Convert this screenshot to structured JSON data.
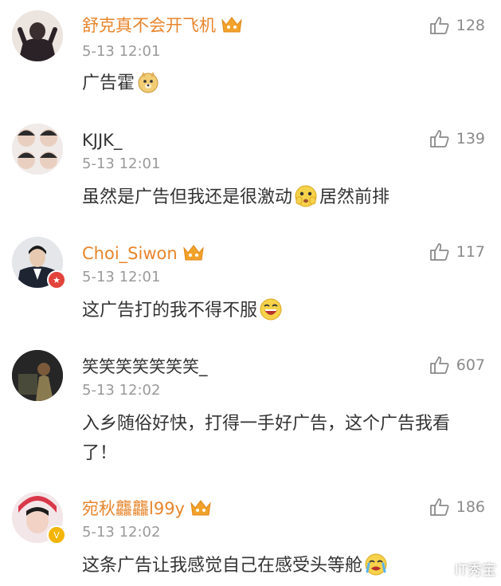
{
  "comments": [
    {
      "username": "舒克真不会开飞机",
      "time": "5-13 12:01",
      "text": "广告霍",
      "likes": "128"
    },
    {
      "username": "KJJK_",
      "time": "5-13 12:01",
      "text_before": "虽然是广告但我还是很激动",
      "text_after": "居然前排",
      "likes": "139"
    },
    {
      "username": "Choi_Siwon",
      "time": "5-13 12:01",
      "text": "这广告打的我不得不服",
      "likes": "117"
    },
    {
      "username": "笑笑笑笑笑笑笑_",
      "time": "5-13 12:02",
      "text": "入乡随俗好快，打得一手好广告，这个广告我看了！",
      "likes": "607"
    },
    {
      "username": "宛秋龘龘l99y",
      "time": "5-13 12:02",
      "text": "这条广告让我感觉自己在感受头等舱",
      "likes": "186"
    }
  ],
  "watermark": "IT秀宝",
  "colors": {
    "vip": "#e8852c",
    "timestamp": "#9a9a9a",
    "divider": "#e6e6e6",
    "crown": "#f2a22a",
    "badge_red": "#e2433a",
    "badge_gold": "#f4b400"
  }
}
